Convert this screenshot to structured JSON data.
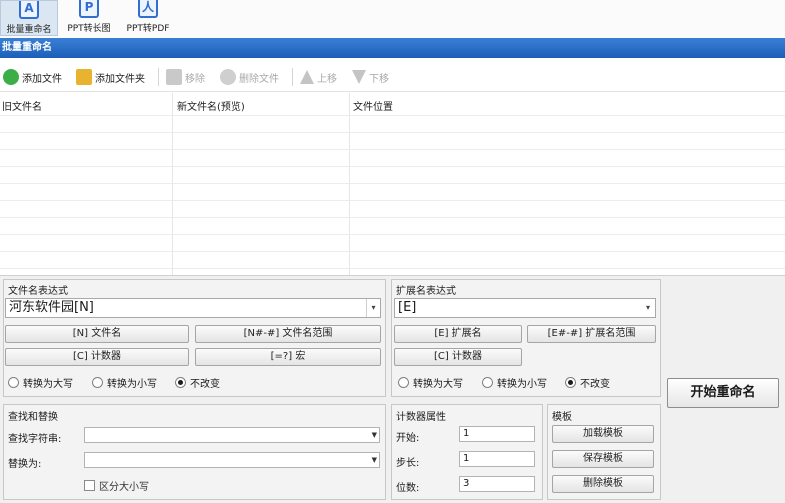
{
  "ribbon": {
    "items": [
      {
        "label": "批量重命名",
        "icon": "rename-icon"
      },
      {
        "label": "PPT转长图",
        "icon": "ppt-image-icon"
      },
      {
        "label": "PPT转PDF",
        "icon": "ppt-pdf-icon"
      }
    ]
  },
  "panel": {
    "title": "批量重命名"
  },
  "toolbar": {
    "add_file": "添加文件",
    "add_folder": "添加文件夹",
    "remove": "移除",
    "delete_file": "删除文件",
    "move_up": "上移",
    "move_down": "下移"
  },
  "table": {
    "columns": [
      "旧文件名",
      "新文件名(预览)",
      "文件位置"
    ]
  },
  "filename_expr": {
    "title": "文件名表达式",
    "value": "河东软件园[N]",
    "btn_n": "[N] 文件名",
    "btn_range": "[N#-#] 文件名范围",
    "btn_counter": "[C] 计数器",
    "btn_macro": "[=?] 宏",
    "radio_upper": "转换为大写",
    "radio_lower": "转换为小写",
    "radio_keep": "不改变"
  },
  "ext_expr": {
    "title": "扩展名表达式",
    "value": "[E]",
    "btn_e": "[E] 扩展名",
    "btn_range": "[E#-#] 扩展名范围",
    "btn_counter": "[C] 计数器",
    "radio_upper": "转换为大写",
    "radio_lower": "转换为小写",
    "radio_keep": "不改变"
  },
  "find_replace": {
    "title": "查找和替换",
    "find_label": "查找字符串:",
    "replace_label": "替换为:",
    "case_label": "区分大小写"
  },
  "counter": {
    "title": "计数器属性",
    "start_label": "开始:",
    "start_value": "1",
    "step_label": "步长:",
    "step_value": "1",
    "digits_label": "位数:",
    "digits_value": "3"
  },
  "template": {
    "title": "模板",
    "load": "加载模板",
    "save": "保存模板",
    "delete": "删除模板"
  },
  "start_button": "开始重命名"
}
